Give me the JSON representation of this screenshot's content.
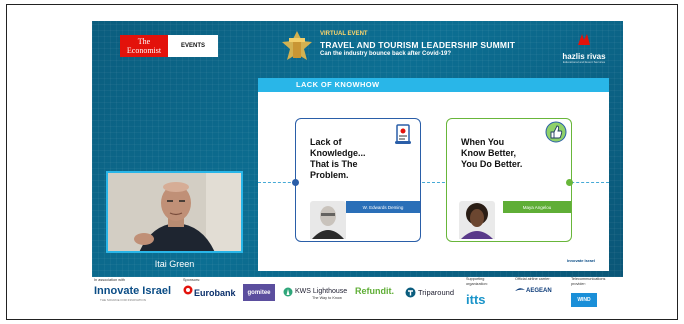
{
  "header": {
    "economist_logo": "The\nEconomist",
    "events_label": "EVENTS",
    "virtual_event": "VIRTUAL EVENT",
    "summit_title": "TRAVEL AND TOURISM LEADERSHIP SUMMIT",
    "summit_subtitle": "Can the industry bounce back after Covid-19?",
    "partner_name": "hazlis rivas",
    "partner_tagline": "Educational and Event Services"
  },
  "slide": {
    "heading": "LACK OF KNOWHOW",
    "cards": [
      {
        "quote": "Lack of\nKnowledge...\nThat is The\nProblem.",
        "author": "W. Edwards Deming",
        "icon": "scroll-icon",
        "accent": "#2a5ea8"
      },
      {
        "quote": "When You\nKnow Better,\nYou Do Better.",
        "author": "Maya Angelou",
        "icon": "thumbs-up-icon",
        "accent": "#68b63a"
      }
    ],
    "footer_logo": "Innovate Israel"
  },
  "speaker": {
    "name": "Itai Green"
  },
  "sponsors": {
    "in_association_label": "In association with",
    "innovate_israel": "Innovate Israel",
    "innovate_tagline": "THE SOURCE FOR INNOVATION",
    "sponsors_label": "Sponsors:",
    "eurobank": "Eurobank",
    "gomitee": "gomitee",
    "kws": "KWS Lighthouse",
    "kws_tag": "The Way to Know",
    "refundit": "Refundit.",
    "triparound": "Triparound",
    "supporting_label": "Supporting organization:",
    "itts": "itts",
    "official_airline_label": "Official airline carrier:",
    "aegean": "AEGEAN",
    "telecom_label": "Telecommunications provider:",
    "wind": "WIND"
  },
  "colors": {
    "stage_bg": "#0c6f93",
    "slide_band": "#29b6e8",
    "economist_red": "#e3120b",
    "deming_blue": "#2a5ea8",
    "angelou_green": "#68b63a"
  }
}
